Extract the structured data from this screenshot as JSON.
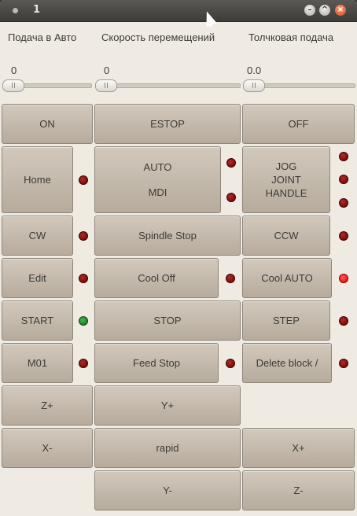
{
  "window": {
    "title": "1"
  },
  "controls": {
    "feed_auto": {
      "label": "Подача в Авто",
      "value": "0",
      "level": 0.0
    },
    "rapid_speed": {
      "label": "Скорость перемещений",
      "value": "0",
      "level": 0.0
    },
    "jog_feed": {
      "label": "Толчковая подача",
      "value": "0.0",
      "level": 0.0
    }
  },
  "buttons": {
    "on": "ON",
    "estop": "ESTOP",
    "off": "OFF",
    "home": "Home",
    "auto": "AUTO",
    "mdi": "MDI",
    "jog": "JOG",
    "joint": "JOINT",
    "handle": "HANDLE",
    "cw": "CW",
    "spindle_stop": "Spindle Stop",
    "ccw": "CCW",
    "edit": "Edit",
    "cool_off": "Cool Off",
    "cool_auto": "Cool AUTO",
    "start": "START",
    "stop": "STOP",
    "step": "STEP",
    "m01": "M01",
    "feed_stop": "Feed Stop",
    "delete_block": "Delete block /",
    "z_plus": "Z+",
    "y_plus": "Y+",
    "x_minus": "X-",
    "rapid": "rapid",
    "x_plus": "X+",
    "y_minus": "Y-",
    "z_minus": "Z-"
  },
  "indicators": {
    "home": "dark-red",
    "auto": "dark-red",
    "mdi": "dark-red",
    "jog": "dark-red",
    "joint": "dark-red",
    "handle": "dark-red",
    "cw": "dark-red",
    "ccw": "dark-red",
    "edit": "dark-red",
    "cool_off": "dark-red",
    "cool_auto": "bright-red",
    "start": "green",
    "step": "dark-red",
    "m01": "dark-red",
    "feed_stop": "dark-red",
    "delete_block": "dark-red"
  },
  "colors": {
    "dark_led": "#8a1010",
    "bright_led": "#ff2020",
    "green_led": "#22a030",
    "button": "#c4baac"
  }
}
